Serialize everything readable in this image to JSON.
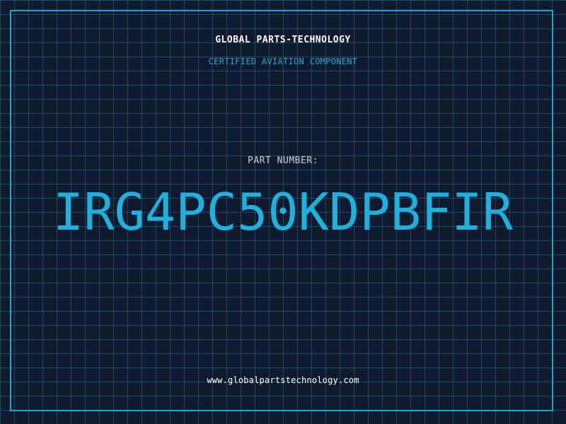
{
  "header": {
    "company": "GLOBAL PARTS-TECHNOLOGY",
    "tagline": "CERTIFIED AVIATION COMPONENT"
  },
  "part": {
    "label": "PART NUMBER:",
    "number": "IRG4PC50KDPBFIR"
  },
  "footer": {
    "website": "www.globalpartstechnology.com"
  },
  "colors": {
    "background": "#101a2e",
    "grid": "#246e8c",
    "accent": "#1fb1dd",
    "frame": "#1ea6cc",
    "text": "#ffffff"
  }
}
